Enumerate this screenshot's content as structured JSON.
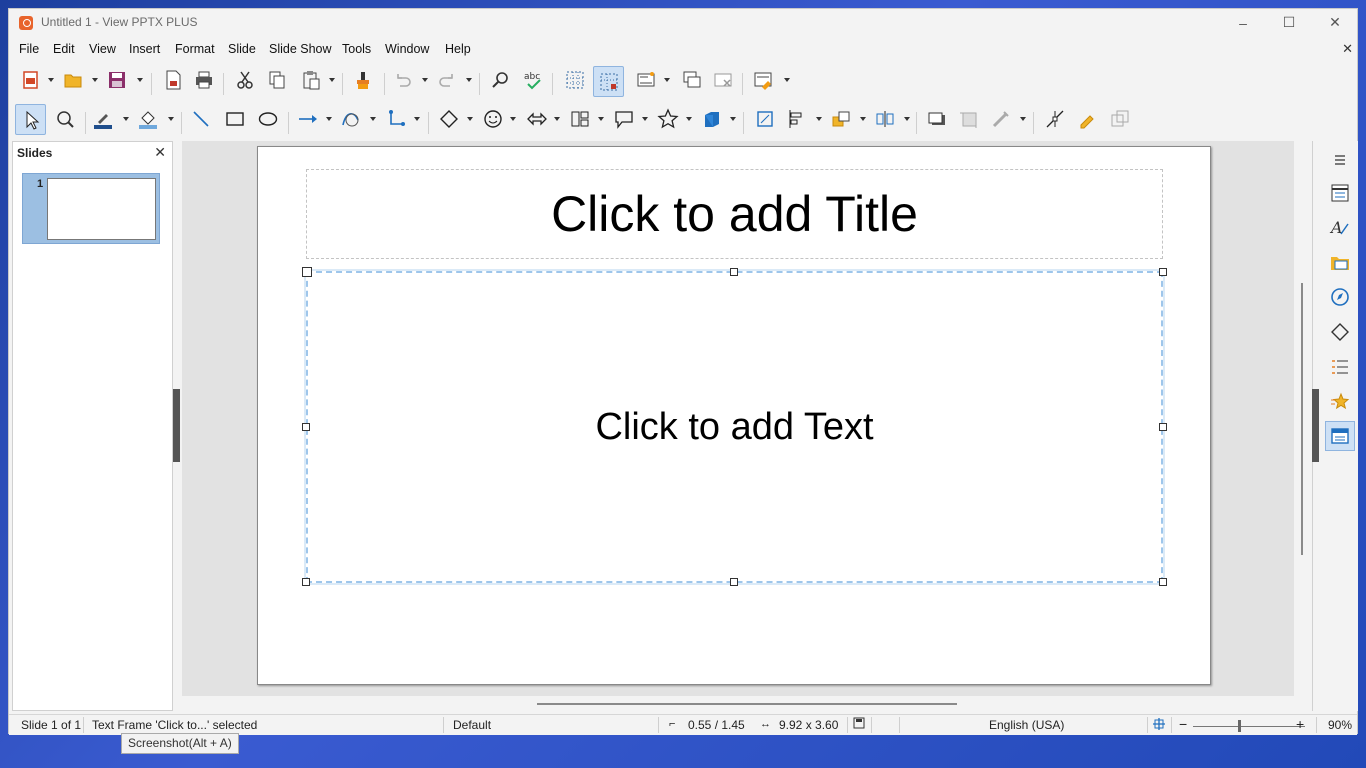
{
  "window": {
    "title": "Untitled 1 - View PPTX PLUS",
    "minimize": "–",
    "maximize": "☐",
    "close": "✕",
    "doc_close": "✕"
  },
  "menu": [
    "File",
    "Edit",
    "View",
    "Insert",
    "Format",
    "Slide",
    "Slide Show",
    "Tools",
    "Window",
    "Help"
  ],
  "slides_pane": {
    "header": "Slides",
    "close": "✕",
    "slide_number": "1"
  },
  "slide": {
    "title_placeholder": "Click to add Title",
    "text_placeholder": "Click to add Text"
  },
  "status": {
    "slide_count": "Slide 1 of 1",
    "selection": "Text Frame 'Click to...' selected",
    "layout": "Default",
    "position": "0.55 / 1.45",
    "size": "9.92 x 3.60",
    "language": "English (USA)",
    "zoom": "90%",
    "zoom_minus": "−",
    "zoom_plus": "+"
  },
  "tooltip": "Screenshot(Alt + A)",
  "colors": {
    "accent": "#1f6fbf",
    "selection_bg": "#cde0f5",
    "app_icon": "#e8642c"
  }
}
